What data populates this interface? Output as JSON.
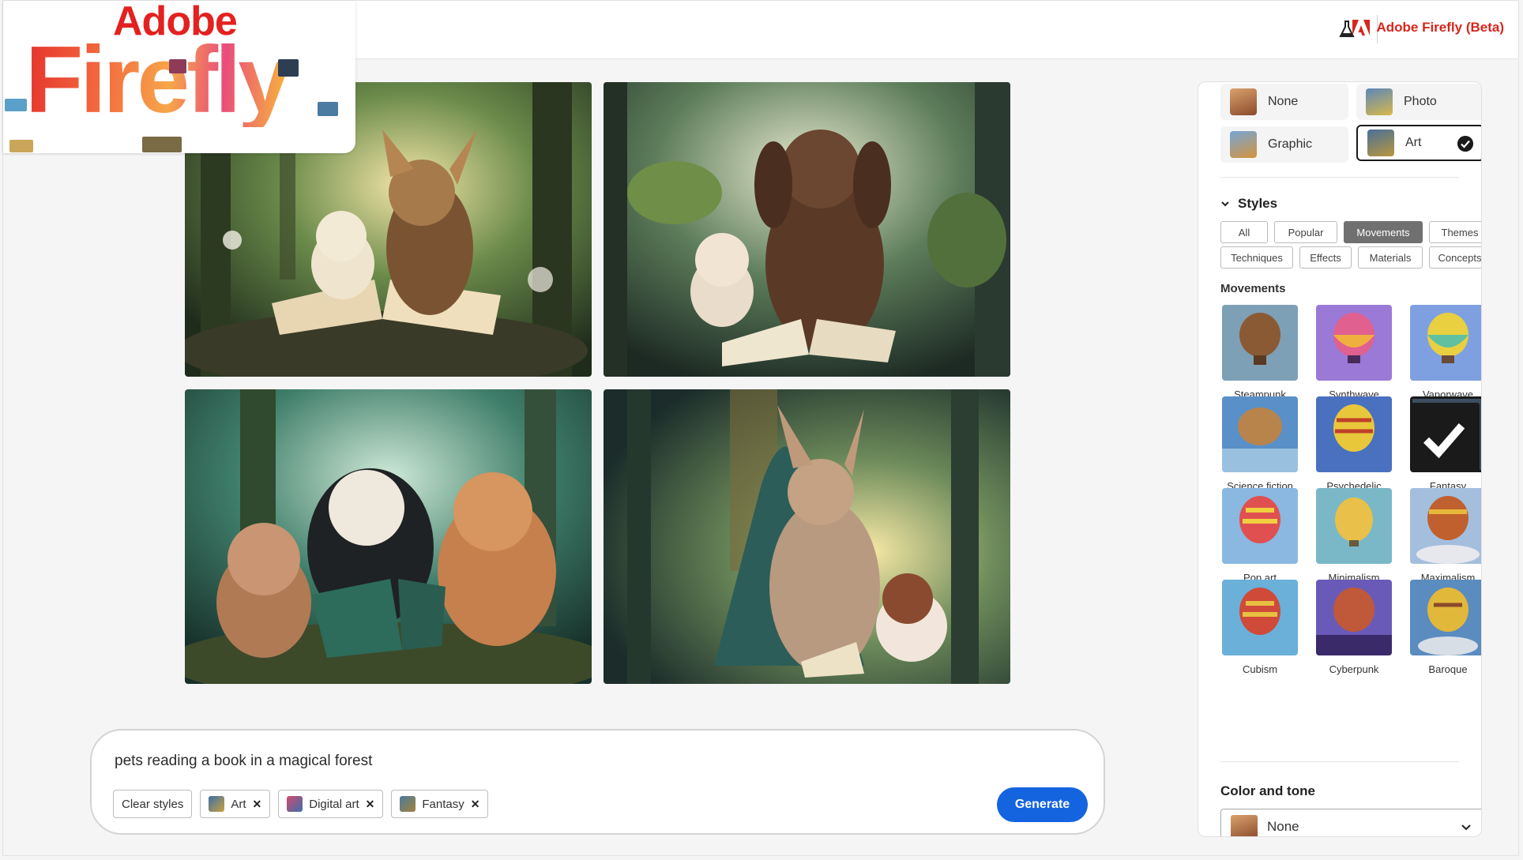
{
  "header": {
    "brand_name": "Adobe Firefly (Beta)",
    "labs_icon": "flask-icon"
  },
  "logo": {
    "adobe_text": "Adobe",
    "firefly_text": "Firefly"
  },
  "gallery": {
    "images": [
      "generated-image-1",
      "generated-image-2",
      "generated-image-3",
      "generated-image-4"
    ]
  },
  "prompt": {
    "text": "pets reading a book in a magical forest",
    "clear_label": "Clear styles",
    "chips": [
      {
        "label": "Art"
      },
      {
        "label": "Digital art"
      },
      {
        "label": "Fantasy"
      }
    ],
    "generate_label": "Generate"
  },
  "panel": {
    "content_types": [
      {
        "label": "None"
      },
      {
        "label": "Photo"
      },
      {
        "label": "Graphic"
      },
      {
        "label": "Art",
        "selected": true
      }
    ],
    "styles_title": "Styles",
    "filters": [
      "All",
      "Popular",
      "Movements",
      "Themes",
      "Techniques",
      "Effects",
      "Materials",
      "Concepts"
    ],
    "active_filter": "Movements",
    "movements_title": "Movements",
    "movements": [
      "Steampunk",
      "Synthwave",
      "Vaporwave",
      "Science fiction",
      "Psychedelic",
      "Fantasy",
      "Pop art",
      "Minimalism",
      "Maximalism",
      "Cubism",
      "Cyberpunk",
      "Baroque"
    ],
    "selected_movement": "Fantasy",
    "color_tone_title": "Color and tone",
    "color_tone_value": "None"
  },
  "colors": {
    "accent": "#1464e0",
    "brand": "#d7261e",
    "selected_border": "#1a1a1a"
  }
}
